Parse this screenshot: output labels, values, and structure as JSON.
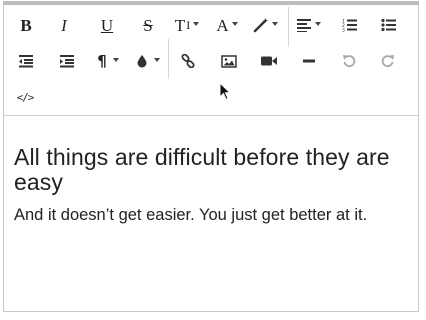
{
  "toolbar": {
    "buttons": [
      {
        "id": "bold",
        "glyph": "B",
        "icon": "bold-icon"
      },
      {
        "id": "italic",
        "glyph": "I",
        "icon": "italic-icon"
      },
      {
        "id": "underline",
        "glyph": "U",
        "icon": "underline-icon"
      },
      {
        "id": "strikethrough",
        "glyph": "S",
        "icon": "strikethrough-icon"
      },
      {
        "id": "font-size",
        "glyph": "T",
        "icon": "font-size-icon",
        "dropdown": true
      },
      {
        "id": "font-color",
        "glyph": "A",
        "icon": "font-color-icon",
        "dropdown": true
      },
      {
        "id": "format",
        "icon": "magic-wand-icon",
        "dropdown": true
      },
      {
        "id": "align",
        "icon": "align-left-icon",
        "dropdown": true
      },
      {
        "id": "ordered-list",
        "icon": "ordered-list-icon"
      },
      {
        "id": "unordered-list",
        "icon": "unordered-list-icon"
      },
      {
        "id": "outdent",
        "icon": "outdent-icon"
      },
      {
        "id": "indent",
        "icon": "indent-icon"
      },
      {
        "id": "paragraph",
        "glyph": "¶",
        "icon": "paragraph-icon",
        "dropdown": true
      },
      {
        "id": "highlight",
        "icon": "ink-drop-icon",
        "dropdown": true
      },
      {
        "id": "link",
        "icon": "link-icon"
      },
      {
        "id": "image",
        "icon": "image-icon"
      },
      {
        "id": "video",
        "icon": "video-icon"
      },
      {
        "id": "horizontal-rule",
        "icon": "horizontal-rule-icon"
      },
      {
        "id": "undo",
        "icon": "undo-icon",
        "disabled": true
      },
      {
        "id": "redo",
        "icon": "redo-icon",
        "disabled": true
      },
      {
        "id": "code-view",
        "glyph": "</>",
        "icon": "code-view-icon"
      }
    ]
  },
  "content": {
    "heading": "All things are difficult before they are easy",
    "paragraph": "And it doesn’t get easier. You just get better at it."
  },
  "colors": {
    "border": "#c8c8c8",
    "icon": "#333333",
    "disabled_icon": "#a9a9a9",
    "text": "#222222"
  }
}
